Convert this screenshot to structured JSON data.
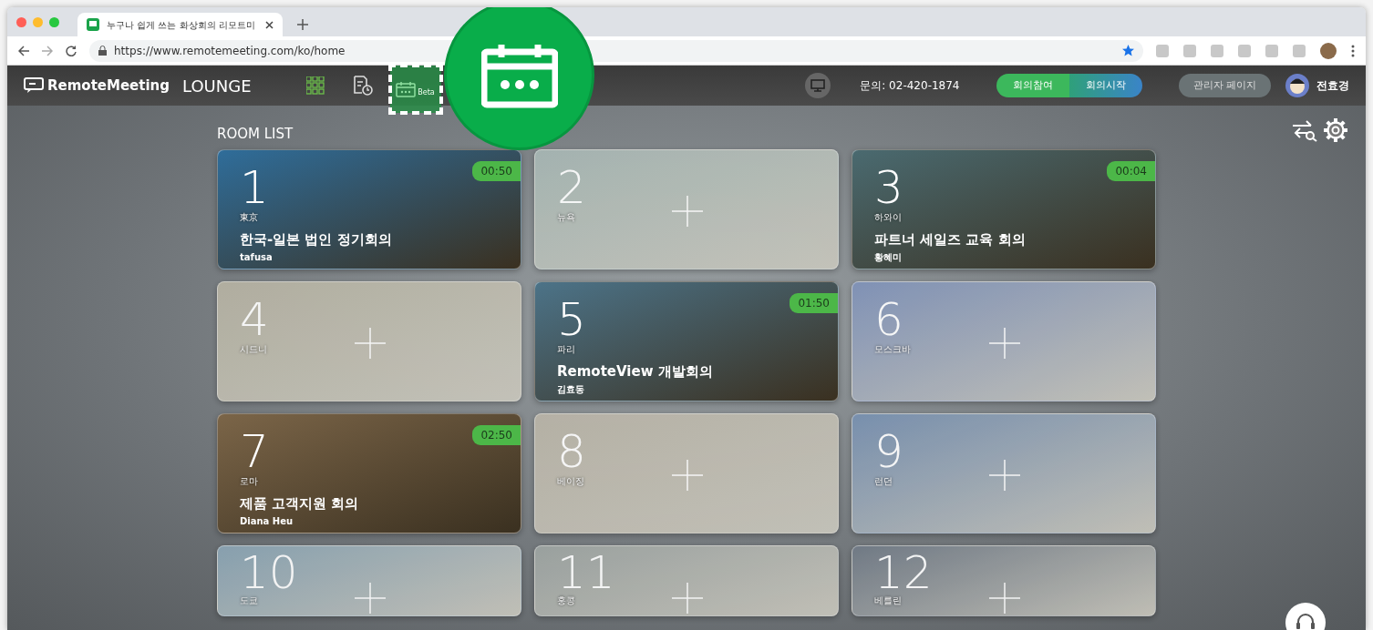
{
  "browser": {
    "tab_title": "누구나 쉽게 쓰는 화상회의 리모트미",
    "url": "https://www.remotemeeting.com/ko/home"
  },
  "navbar": {
    "logo": "RemoteMeeting",
    "product": "LOUNGE",
    "nav_items": [
      {
        "kind": "grid",
        "selected": false
      },
      {
        "kind": "history",
        "selected": false
      },
      {
        "kind": "calendar",
        "label": "Beta",
        "selected": true
      }
    ],
    "contact": "문의: 02-420-1874",
    "join_button": "회의참여",
    "start_button": "회의시작",
    "admin_button": "관리자 페이지",
    "user_name": "전효경"
  },
  "section_title": "ROOM LIST",
  "rooms": [
    {
      "number": "1",
      "city": "東京",
      "in_use": true,
      "timer": "00:50",
      "title": "한국-일본 법인 정기회의",
      "host": "tafusa"
    },
    {
      "number": "2",
      "city": "뉴욕",
      "in_use": false
    },
    {
      "number": "3",
      "city": "하와이",
      "in_use": true,
      "timer": "00:04",
      "title": "파트너 세일즈 교육 회의",
      "host": "황혜미"
    },
    {
      "number": "4",
      "city": "시드니",
      "in_use": false
    },
    {
      "number": "5",
      "city": "파리",
      "in_use": true,
      "timer": "01:50",
      "title": "RemoteView 개발회의",
      "host": "김효동"
    },
    {
      "number": "6",
      "city": "모스크바",
      "in_use": false
    },
    {
      "number": "7",
      "city": "로마",
      "in_use": true,
      "timer": "02:50",
      "title": "제품 고객지원 회의",
      "host": "Diana Heu"
    },
    {
      "number": "8",
      "city": "베이징",
      "in_use": false
    },
    {
      "number": "9",
      "city": "런던",
      "in_use": false
    },
    {
      "number": "10",
      "city": "도쿄",
      "in_use": false
    },
    {
      "number": "11",
      "city": "홍콩",
      "in_use": false
    },
    {
      "number": "12",
      "city": "베를린",
      "in_use": false
    }
  ]
}
